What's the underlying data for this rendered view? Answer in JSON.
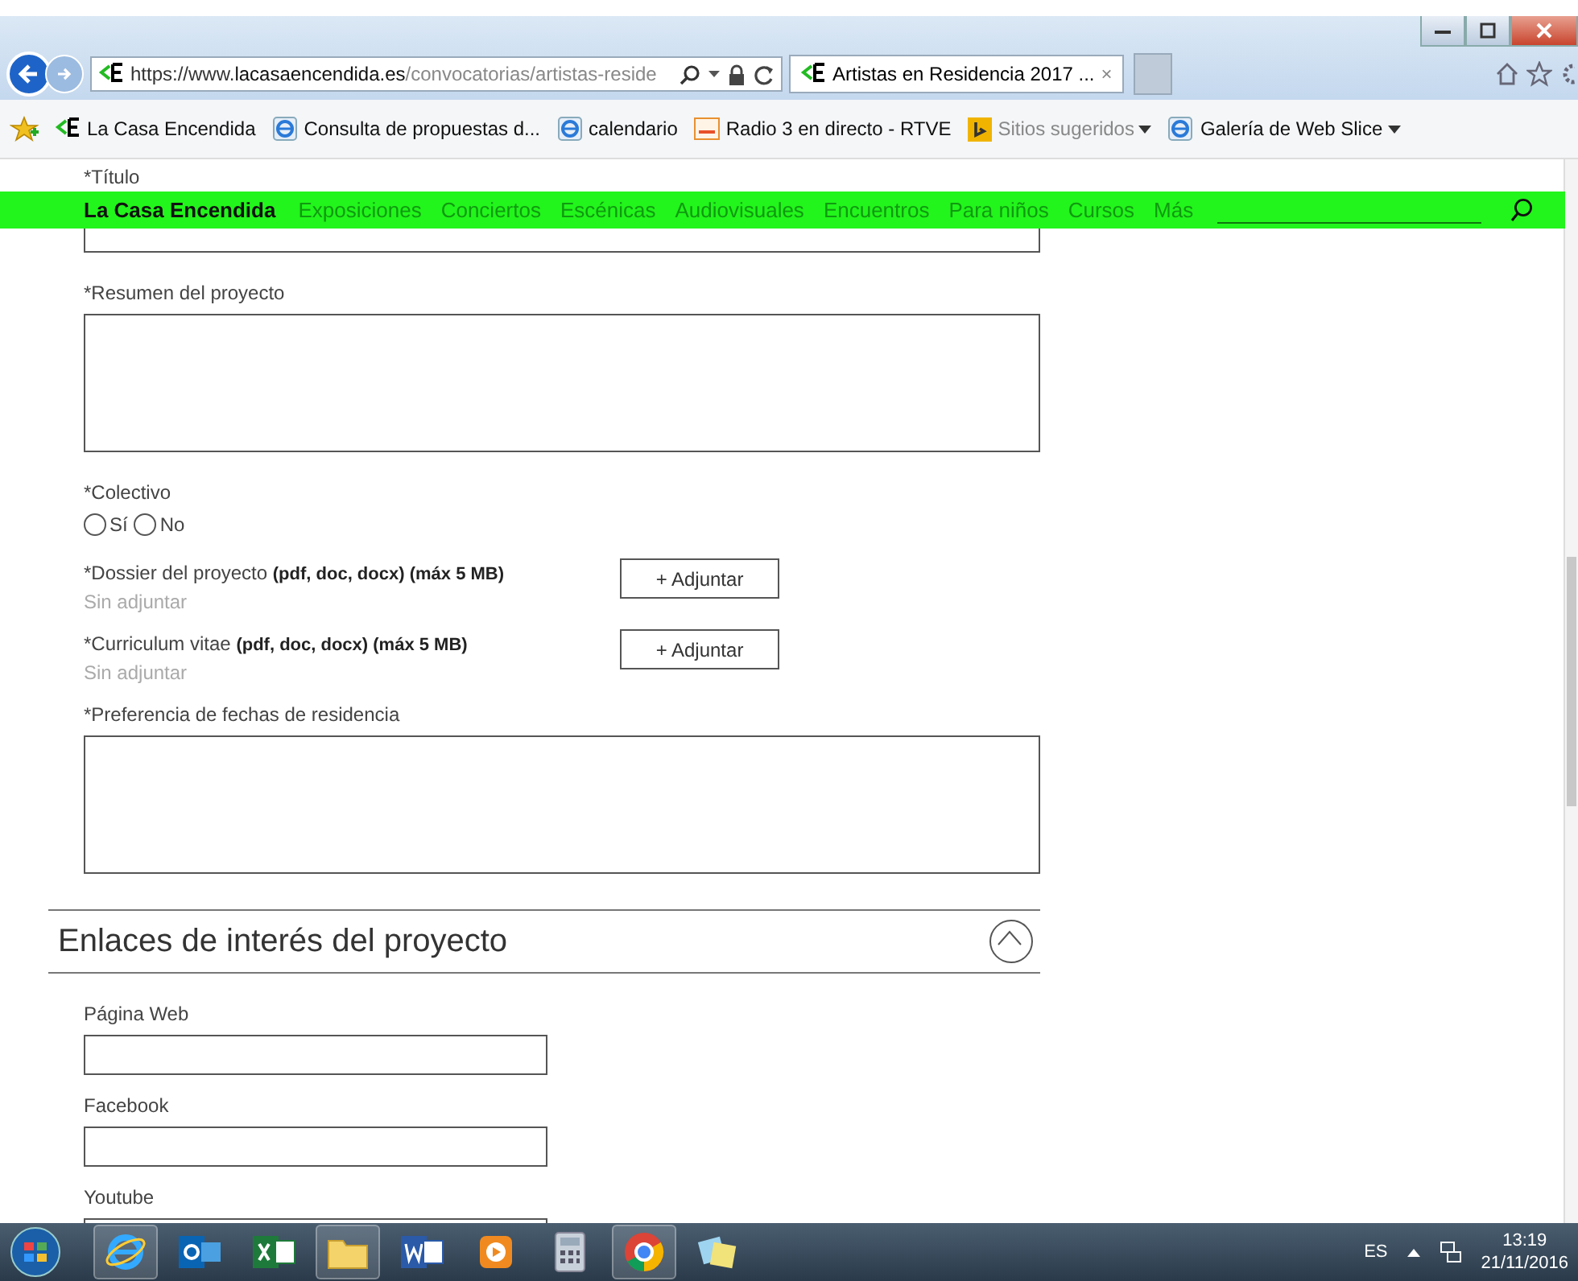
{
  "browser": {
    "address": {
      "scheme": "https://www.",
      "host": "lacasaencendida.es",
      "path": "/convocatorias/artistas-reside"
    },
    "tab": {
      "title": "Artistas en Residencia 2017 ...",
      "close": "×",
      "selected": true
    },
    "favorites": [
      {
        "label": "La Casa Encendida",
        "kind": "site",
        "dropdown": false,
        "dimmed": false
      },
      {
        "label": "Consulta de propuestas d...",
        "kind": "ie",
        "dropdown": false,
        "dimmed": false
      },
      {
        "label": "calendario",
        "kind": "ie",
        "dropdown": false,
        "dimmed": false
      },
      {
        "label": "Radio 3 en directo - RTVE",
        "kind": "rtve",
        "dropdown": false,
        "dimmed": false
      },
      {
        "label": "Sitios sugeridos",
        "kind": "bing",
        "dropdown": true,
        "dimmed": true
      },
      {
        "label": "Galería de Web Slice",
        "kind": "ie",
        "dropdown": true,
        "dimmed": false
      }
    ]
  },
  "site_nav": {
    "brand": "La Casa Encendida",
    "items": [
      "Exposiciones",
      "Conciertos",
      "Escénicas",
      "Audiovisuales",
      "Encuentros",
      "Para niños",
      "Cursos",
      "Más"
    ]
  },
  "form": {
    "fields": [
      {
        "kind": "text",
        "label": "*Título"
      },
      {
        "kind": "textarea",
        "label": "*Resumen del proyecto"
      },
      {
        "kind": "radio",
        "label": "*Colectivo",
        "options": [
          {
            "label": "Sí",
            "selected": false
          },
          {
            "label": "No",
            "selected": false
          }
        ]
      },
      {
        "kind": "file",
        "label": "*Dossier del proyecto **(pdf, doc, docx) (máx 5 MB)**",
        "status": "Sin adjuntar",
        "button": "+ Adjuntar"
      },
      {
        "kind": "file",
        "label": "*Curriculum vitae **(pdf, doc, docx) (máx 5 MB)**",
        "status": "Sin adjuntar",
        "button": "+ Adjuntar"
      },
      {
        "kind": "textarea",
        "label": "*Preferencia de fechas de residencia"
      },
      {
        "kind": "section",
        "title": "Enlaces de interés del proyecto",
        "expanded": true
      },
      {
        "kind": "text",
        "label": "Página Web"
      },
      {
        "kind": "text",
        "label": "Facebook"
      },
      {
        "kind": "text",
        "label": "Youtube"
      }
    ]
  },
  "taskbar": {
    "language": "ES",
    "time": "13:19",
    "date": "21/11/2016"
  }
}
